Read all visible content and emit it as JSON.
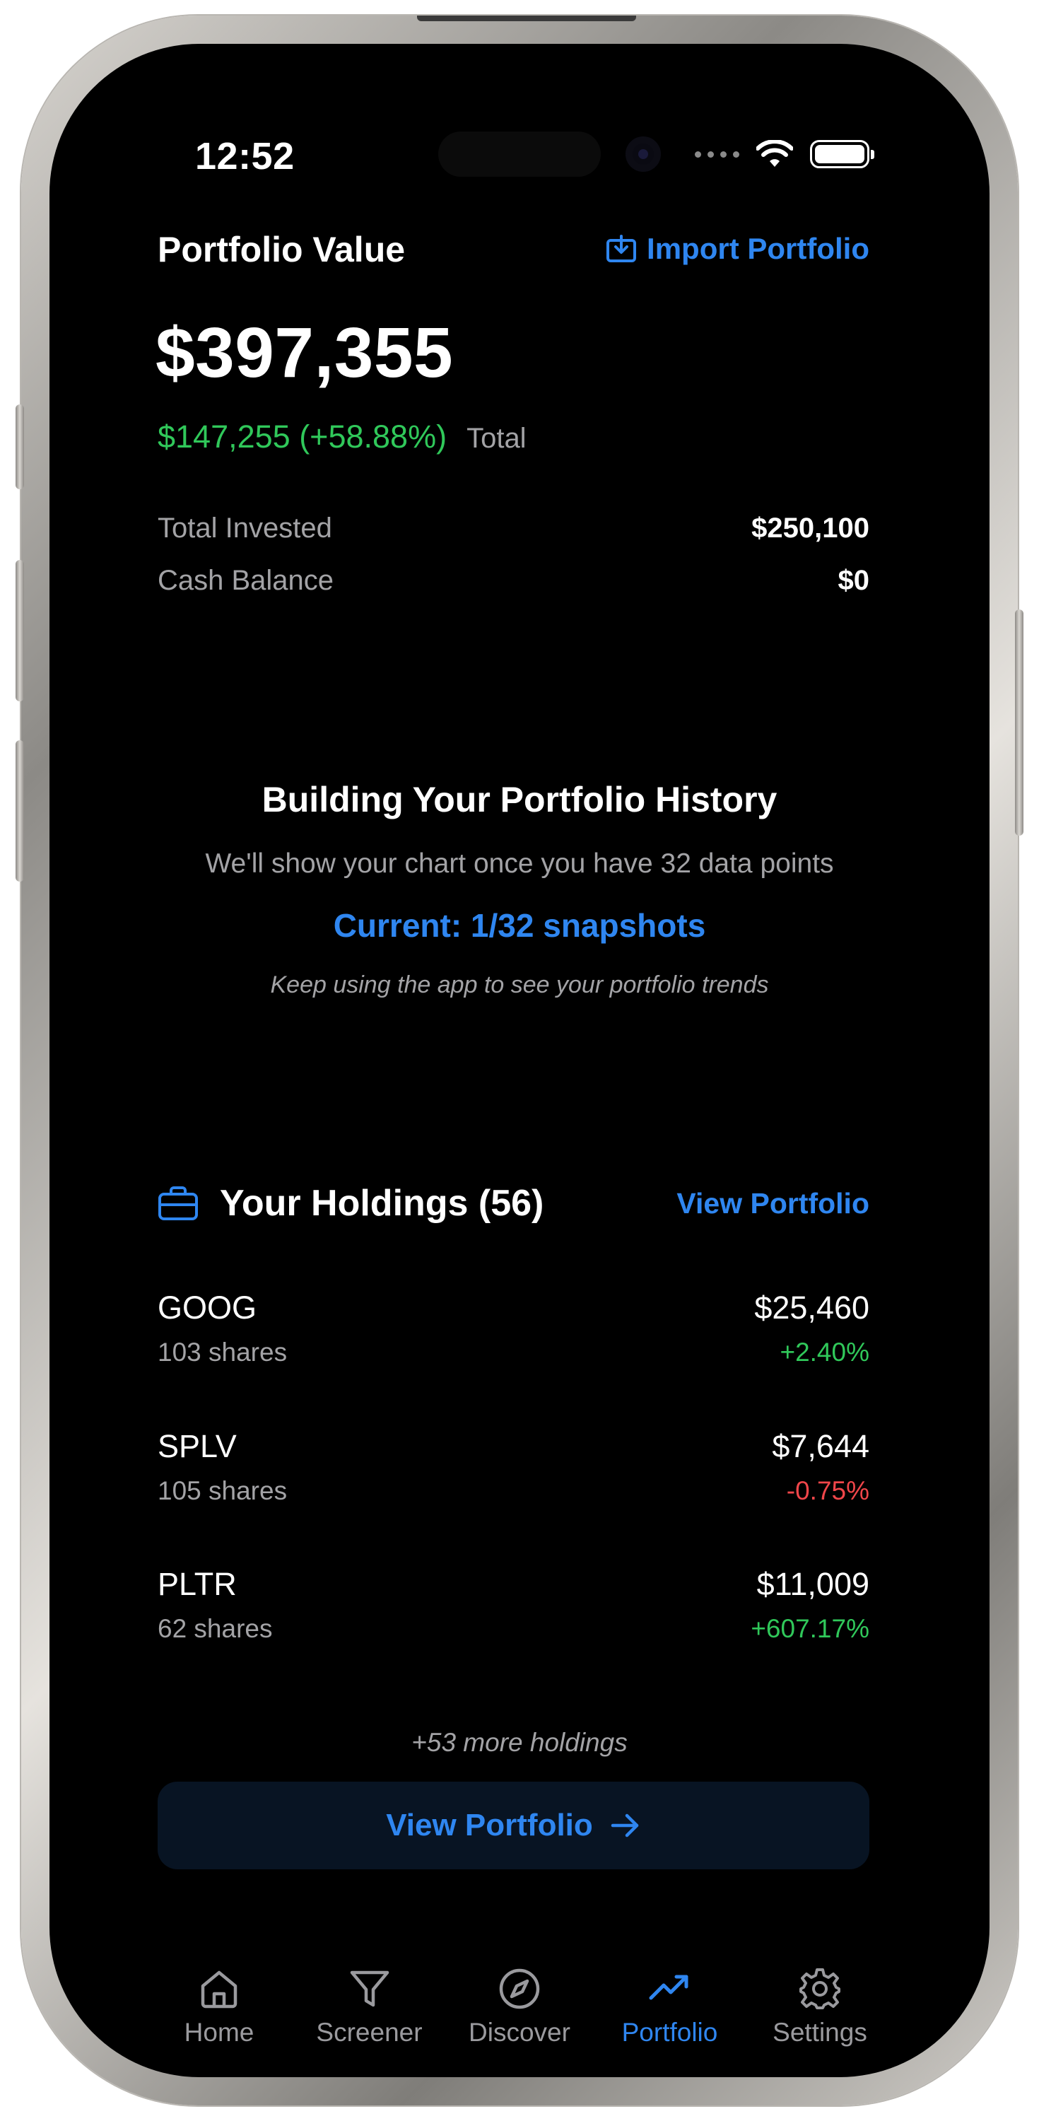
{
  "status_bar": {
    "time": "12:52"
  },
  "header": {
    "title": "Portfolio Value",
    "import_label": "Import Portfolio"
  },
  "portfolio": {
    "value": "$397,355",
    "change": "$147,255 (+58.88%)",
    "change_period": "Total",
    "total_invested_label": "Total Invested",
    "total_invested_value": "$250,100",
    "cash_balance_label": "Cash Balance",
    "cash_balance_value": "$0"
  },
  "history": {
    "title": "Building Your Portfolio History",
    "subtitle": "We'll show your chart once you have 32 data points",
    "progress": "Current: 1/32 snapshots",
    "hint": "Keep using the app to see your portfolio trends"
  },
  "holdings": {
    "title": "Your Holdings (56)",
    "view_link": "View Portfolio",
    "items": [
      {
        "symbol": "GOOG",
        "shares": "103 shares",
        "value": "$25,460",
        "change": "+2.40%",
        "direction": "up"
      },
      {
        "symbol": "SPLV",
        "shares": "105 shares",
        "value": "$7,644",
        "change": "-0.75%",
        "direction": "down"
      },
      {
        "symbol": "PLTR",
        "shares": "62 shares",
        "value": "$11,009",
        "change": "+607.17%",
        "direction": "up"
      }
    ],
    "more_label": "+53 more holdings",
    "view_button_label": "View Portfolio"
  },
  "tabs": [
    {
      "label": "Home",
      "icon": "home-icon",
      "active": false
    },
    {
      "label": "Screener",
      "icon": "filter-icon",
      "active": false
    },
    {
      "label": "Discover",
      "icon": "compass-icon",
      "active": false
    },
    {
      "label": "Portfolio",
      "icon": "trending-up-icon",
      "active": true
    },
    {
      "label": "Settings",
      "icon": "gear-icon",
      "active": false
    }
  ],
  "colors": {
    "accent": "#2f86f0",
    "positive": "#30c85a",
    "negative": "#f0464a",
    "background": "#000000"
  }
}
